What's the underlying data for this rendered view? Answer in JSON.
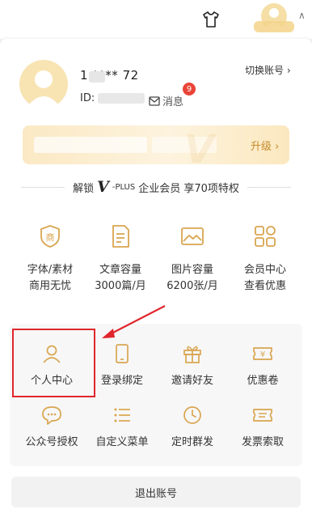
{
  "header": {
    "shirt_icon": "tshirt-icon",
    "avatar_icon": "user-avatar-icon",
    "caret_icon": "chevron-up-icon"
  },
  "profile": {
    "phone": "1  ****  72",
    "id_label": "ID:",
    "message_label": "消息",
    "message_count": "9",
    "switch_account": "切换账号 ›"
  },
  "vip": {
    "upgrade_label": "升级 ›"
  },
  "unlock": {
    "prefix": "解锁",
    "logo": "V",
    "plus": "-PLUS",
    "suffix": "企业会员 享70项特权"
  },
  "benefits": [
    {
      "icon": "shield-shang-icon",
      "line1": "字体/素材",
      "line2": "商用无忧"
    },
    {
      "icon": "document-icon",
      "line1": "文章容量",
      "line2": "3000篇/月"
    },
    {
      "icon": "image-icon",
      "line1": "图片容量",
      "line2": "6200张/月"
    },
    {
      "icon": "grid-apps-icon",
      "line1": "会员中心",
      "line2": "查看优惠"
    }
  ],
  "tools": [
    {
      "icon": "user-icon",
      "label": "个人中心"
    },
    {
      "icon": "phone-icon",
      "label": "登录绑定"
    },
    {
      "icon": "gift-icon",
      "label": "邀请好友"
    },
    {
      "icon": "coupon-icon",
      "label": "优惠卷"
    },
    {
      "icon": "chat-bubble-icon",
      "label": "公众号授权"
    },
    {
      "icon": "list-menu-icon",
      "label": "自定义菜单"
    },
    {
      "icon": "clock-icon",
      "label": "定时群发"
    },
    {
      "icon": "ticket-icon",
      "label": "发票索取"
    }
  ],
  "footer": {
    "logout_label": "退出账号"
  },
  "colors": {
    "accent_gold": "#d9a550",
    "badge_red": "#e94437",
    "highlight_red": "#e0262c"
  }
}
